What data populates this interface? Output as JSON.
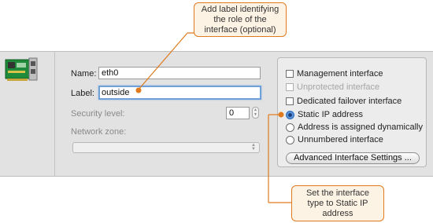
{
  "form": {
    "name_label": "Name:",
    "name_value": "eth0",
    "label_label": "Label:",
    "label_value": "outside",
    "security_label": "Security level:",
    "security_value": "0",
    "zone_label": "Network zone:",
    "zone_value": ""
  },
  "options": {
    "management": "Management interface",
    "unprotected": "Unprotected interface",
    "failover": "Dedicated failover interface",
    "static_ip": "Static IP address",
    "dynamic": "Address is assigned dynamically",
    "unnumbered": "Unnumbered interface",
    "advanced_button": "Advanced Interface Settings ..."
  },
  "callouts": {
    "top": "Add label identifying\nthe role of the\ninterface (optional)",
    "bottom": "Set the interface\ntype to Static IP\naddress"
  },
  "colors": {
    "callout_border": "#e07a1e",
    "callout_fill": "#fdf3e4",
    "focus_ring": "#6fa0d8"
  },
  "icons": {
    "nic": "network-card-icon"
  }
}
